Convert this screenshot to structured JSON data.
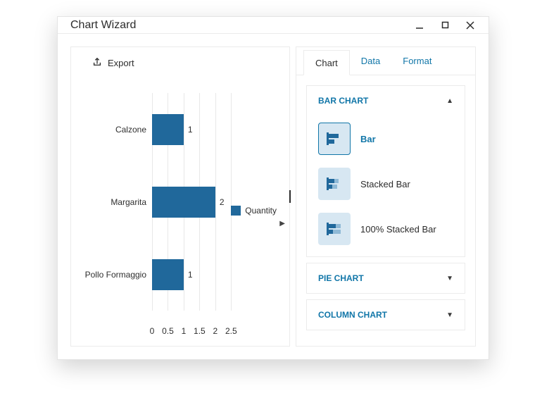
{
  "window": {
    "title": "Chart Wizard"
  },
  "export_label": "Export",
  "legend_label": "Quantity",
  "chart_data": {
    "type": "bar",
    "orientation": "horizontal",
    "categories": [
      "Calzone",
      "Margarita",
      "Pollo Formaggio"
    ],
    "values": [
      1,
      2,
      1
    ],
    "series_name": "Quantity",
    "xticks": [
      0,
      0.5,
      1,
      1.5,
      2,
      2.5
    ],
    "xlim": [
      0,
      2.5
    ],
    "title": "",
    "xlabel": "",
    "ylabel": "",
    "color": "#20689b"
  },
  "tabs": [
    {
      "label": "Chart",
      "active": true
    },
    {
      "label": "Data",
      "active": false
    },
    {
      "label": "Format",
      "active": false
    }
  ],
  "accordion": {
    "bar_chart": {
      "title": "BAR CHART",
      "expanded": true,
      "options": [
        {
          "label": "Bar",
          "selected": true
        },
        {
          "label": "Stacked Bar",
          "selected": false
        },
        {
          "label": "100% Stacked Bar",
          "selected": false
        }
      ]
    },
    "pie_chart": {
      "title": "PIE CHART",
      "expanded": false
    },
    "column_chart": {
      "title": "COLUMN CHART",
      "expanded": false
    }
  }
}
